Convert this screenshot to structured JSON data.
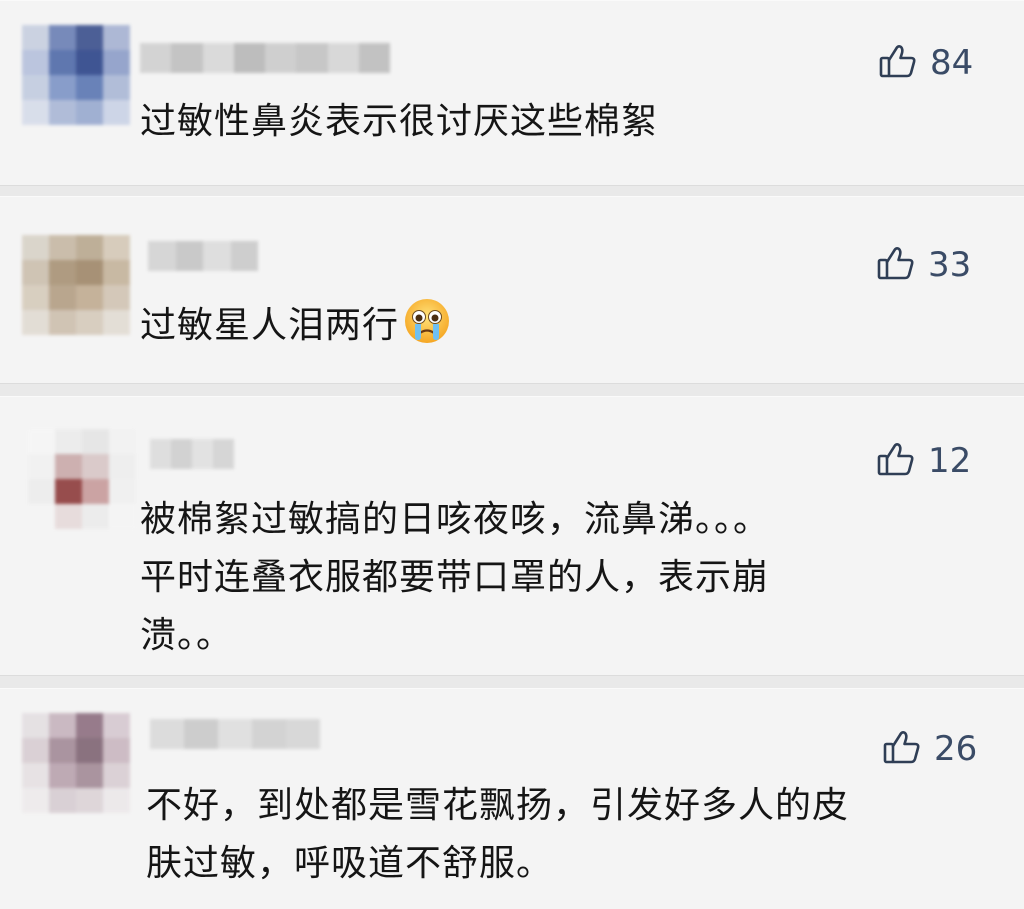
{
  "comments": [
    {
      "likes": "84",
      "text_lines": [
        "过敏性鼻炎表示很讨厌这些棉絮"
      ],
      "avatar_colors": [
        "#c7cfe0",
        "#6a7fb4",
        "#3a4f8c",
        "#a6b2d2",
        "#b5c0dc",
        "#4f6aa8",
        "#2c4489",
        "#8c9dc8",
        "#c2cce0",
        "#7d94c6",
        "#5a76b2",
        "#aab8d6",
        "#d6dcea",
        "#a9b7d6",
        "#98a9cf",
        "#c9d2e6"
      ],
      "username_colors": [
        "#d3d3d3",
        "#c4c4c4",
        "#dadada",
        "#bdbdbd",
        "#cfcfcf",
        "#c7c7c7",
        "#d8d8d8",
        "#c2c2c2"
      ]
    },
    {
      "likes": "33",
      "text_lines": [
        "过敏星人泪两行"
      ],
      "emoji": "crying-face-emoji",
      "avatar_colors": [
        "#d8d2c7",
        "#c6b8a4",
        "#b9a88f",
        "#d4c8b6",
        "#cbbfae",
        "#a89275",
        "#9f8769",
        "#c4b39b",
        "#d6cbbb",
        "#b39e84",
        "#c0ab91",
        "#d1c4b3",
        "#e1dbd2",
        "#cdbfae",
        "#d5cabb",
        "#e2dcd3"
      ],
      "username_colors": [
        "#d6d6d6",
        "#c9c9c9",
        "#dedede",
        "#cecece"
      ]
    },
    {
      "likes": "12",
      "text_lines": [
        "被棉絮过敏搞的日咳夜咳，流鼻涕。。。",
        "平时连叠衣服都要带口罩的人，表示崩",
        "溃。。"
      ],
      "avatar_colors": [
        "#f6f6f6",
        "#ececec",
        "#e5e5e5",
        "#f2f2f2",
        "#f1f1f1",
        "#c9a9a9",
        "#d8c6c6",
        "#eeeeee",
        "#ededed",
        "#8e3b3b",
        "#c79b9b",
        "#f0f0f0",
        "#f4f4f4",
        "#e6dada",
        "#ececec",
        "#f5f5f5"
      ],
      "username_colors": [
        "#dedede",
        "#d2d2d2",
        "#e2e2e2",
        "#d6d6d6"
      ]
    },
    {
      "likes": "26",
      "text_lines": [
        "不好，到处都是雪花飘扬，引发好多人的皮",
        "肤过敏，呼吸道不舒服。"
      ],
      "avatar_colors": [
        "#e4dfe2",
        "#c6b3bd",
        "#8d6f80",
        "#d6c8d0",
        "#d8cdd2",
        "#a38a97",
        "#7f6473",
        "#c9b7c0",
        "#e6e1e3",
        "#b9a2ae",
        "#a28a96",
        "#d9ced3",
        "#eeebec",
        "#d7cdd2",
        "#dcd3d7",
        "#ece8ea"
      ],
      "username_colors": [
        "#dcdcdc",
        "#cdcdcd",
        "#e0e0e0",
        "#d3d3d3",
        "#d8d8d8"
      ]
    }
  ]
}
